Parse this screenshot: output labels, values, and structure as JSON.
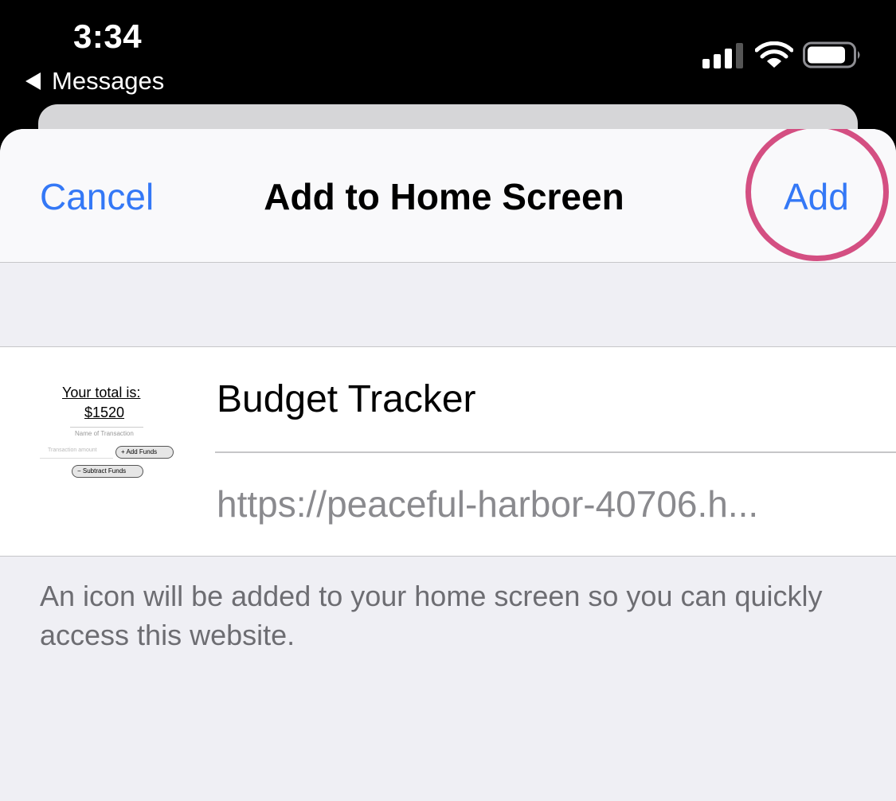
{
  "status_bar": {
    "time": "3:34",
    "back_label": "Messages",
    "signal_icon": "cellular-signal-icon",
    "wifi_icon": "wifi-icon",
    "battery_icon": "battery-icon"
  },
  "nav": {
    "cancel_label": "Cancel",
    "title": "Add to Home Screen",
    "add_label": "Add",
    "highlight_color": "#d44f82",
    "accent_color": "#3478f6"
  },
  "form": {
    "thumbnail": {
      "line1": "Your total is:",
      "line2": "$1520",
      "line3": "Name of Transaction",
      "input_placeholder": "Transaction amount",
      "add_button": "+ Add Funds",
      "subtract_button": "− Subtract Funds"
    },
    "name_value": "Budget Tracker",
    "url_value": "https://peaceful-harbor-40706.h..."
  },
  "footer": {
    "note": "An icon will be added to your home screen so you can quickly access this website."
  }
}
